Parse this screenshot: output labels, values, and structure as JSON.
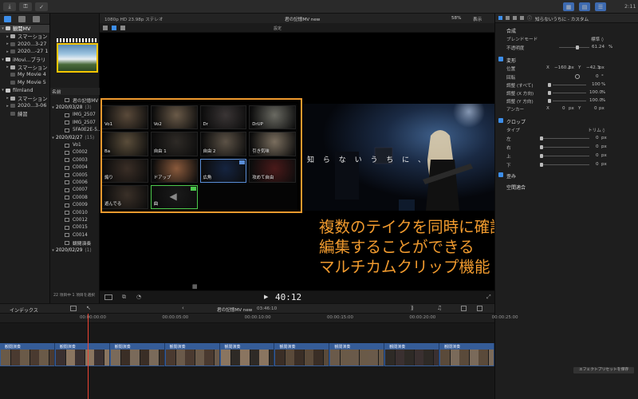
{
  "toolbar": {
    "import_icon": "download-arrow-icon",
    "key_icon": "key-icon",
    "check_icon": "checkmark-circle-icon",
    "clock": "2:11"
  },
  "libraries": {
    "items": [
      {
        "label": "観閲MV",
        "depth": 0,
        "expand": "▾",
        "icon": "lib",
        "selected": true
      },
      {
        "label": "スマーション",
        "depth": 1,
        "expand": "▸",
        "icon": "star"
      },
      {
        "label": "2020...3-27",
        "depth": 1,
        "expand": "▸",
        "icon": "event"
      },
      {
        "label": "2020...-27 1",
        "depth": 1,
        "expand": "▸",
        "icon": "event"
      },
      {
        "label": "iMovi...ブラリ",
        "depth": 0,
        "expand": "▾",
        "icon": "lib"
      },
      {
        "label": "スマーション",
        "depth": 1,
        "expand": "▸",
        "icon": "star"
      },
      {
        "label": "My Movie 4",
        "depth": 1,
        "expand": "",
        "icon": "event"
      },
      {
        "label": "My Movie 5",
        "depth": 1,
        "expand": "",
        "icon": "event"
      },
      {
        "label": "filmland",
        "depth": 0,
        "expand": "▾",
        "icon": "lib"
      },
      {
        "label": "スマーション",
        "depth": 1,
        "expand": "▸",
        "icon": "star"
      },
      {
        "label": "2020...3-06",
        "depth": 1,
        "expand": "▸",
        "icon": "event"
      },
      {
        "label": "練習",
        "depth": 1,
        "expand": "",
        "icon": "event"
      }
    ]
  },
  "browser": {
    "name_header": "名前",
    "rows": [
      {
        "label": "君の記憶MV ",
        "kind": "clip",
        "indent": 1
      },
      {
        "label": "2020/03/28",
        "count": "(3)",
        "kind": "date"
      },
      {
        "label": "IMG_2507",
        "kind": "clip"
      },
      {
        "label": "IMG_2507",
        "kind": "clip"
      },
      {
        "label": "5FA0E2E-5...",
        "kind": "clip"
      },
      {
        "label": "2020/02/27",
        "count": "(15)",
        "kind": "date"
      },
      {
        "label": "Vo1",
        "kind": "clip"
      },
      {
        "label": "C0002",
        "kind": "clip"
      },
      {
        "label": "C0003",
        "kind": "clip"
      },
      {
        "label": "C0004",
        "kind": "clip"
      },
      {
        "label": "C0005",
        "kind": "clip"
      },
      {
        "label": "C0006",
        "kind": "clip"
      },
      {
        "label": "C0007",
        "kind": "clip"
      },
      {
        "label": "C0008",
        "kind": "clip"
      },
      {
        "label": "C0009",
        "kind": "clip"
      },
      {
        "label": "C0010",
        "kind": "clip"
      },
      {
        "label": "C0012",
        "kind": "clip"
      },
      {
        "label": "C0015",
        "kind": "clip"
      },
      {
        "label": "C0014",
        "kind": "clip"
      },
      {
        "label": "観閲演奏",
        "kind": "clip"
      },
      {
        "label": "2020/02/29",
        "count": "(1)",
        "kind": "date"
      }
    ],
    "footer": "22 項目中 1 項目を選択"
  },
  "viewer": {
    "format": "1080p HD 23.98p ステレオ",
    "title": "君の記憶MV new",
    "zoom": "58%",
    "view_label": "表示",
    "settings_label": "設定",
    "timecode": "40:12",
    "preview_title": "知 ら な い う ち に 、",
    "angles": [
      {
        "label": "Vo1",
        "tone": "#5a4a3a"
      },
      {
        "label": "Vo2",
        "tone": "#6a5a48"
      },
      {
        "label": "Dr",
        "tone": "#3a3535"
      },
      {
        "label": "DrUP",
        "tone": "#6a6a62"
      },
      {
        "label": "Ba",
        "tone": "#5a4d3a"
      },
      {
        "label": "自由 1",
        "tone": "#2e2a26"
      },
      {
        "label": "自由 2",
        "tone": "#5c5246"
      },
      {
        "label": "引き気味",
        "tone": "#7a6e5e"
      },
      {
        "label": "煽り",
        "tone": "#3a2e26"
      },
      {
        "label": "ドアップ",
        "tone": "#8a5a3c"
      },
      {
        "label": "広角",
        "tone": "#152440",
        "selected": true
      },
      {
        "label": "攻めて自由",
        "tone": "#4a1a1a"
      },
      {
        "label": "遊んでる",
        "tone": "#3a3028"
      },
      {
        "label": "曲",
        "tone": "#1a1a1a",
        "audio": true,
        "active": true
      }
    ]
  },
  "caption": {
    "line1": "複数のテイクを同時に確認しながら",
    "line2": "編集することができる",
    "line3": "マルチカムクリップ機能"
  },
  "inspector": {
    "title": "知らないうちに - カスタム",
    "composite": "合成",
    "blend_mode_label": "ブレンドモード",
    "blend_mode_value": "標準 ◊",
    "opacity_label": "不透明度",
    "opacity_value": "61.24",
    "opacity_unit": "%",
    "opacity_fraction": 0.6124,
    "transform": "変形",
    "position_label": "位置",
    "pos_x_label": "X",
    "pos_x_value": "−160.2",
    "pos_y_label": "Y",
    "pos_y_value": "−42.3",
    "px_unit": "px",
    "rotation_label": "回転",
    "rotation_value": "0",
    "degree_unit": "°",
    "scale_all_label": "調整 (すべて)",
    "scale_all_value": "100",
    "scale_x_label": "調整 (X 方向)",
    "scale_x_value": "100.0",
    "scale_y_label": "調整 (Y 方向)",
    "scale_y_value": "100.0",
    "percent_unit": "%",
    "anchor_label": "アンカー",
    "anchor_x_label": "X",
    "anchor_x_value": "0",
    "anchor_y_label": "Y",
    "anchor_y_value": "0",
    "crop": "クロップ",
    "type_label": "タイプ",
    "type_value": "トリム ◊",
    "left_label": "左",
    "left_value": "0",
    "right_label": "右",
    "right_value": "0",
    "top_label": "上",
    "top_value": "0",
    "bottom_label": "下",
    "bottom_value": "0",
    "distort": "歪み",
    "spatial": "空間適合",
    "save_preset": "エフェクトプリセットを保存"
  },
  "timeline": {
    "index_label": "インデックス",
    "project_name": "君の記憶MV new",
    "duration": "03:46:10",
    "ruler": [
      "00:00:00:00",
      "00:00:05:00",
      "00:00:10:00",
      "00:00:15:00",
      "00:00:20:00",
      "00:00:25:00"
    ],
    "clip_label": "観閲演奏",
    "clip_count": 9
  }
}
